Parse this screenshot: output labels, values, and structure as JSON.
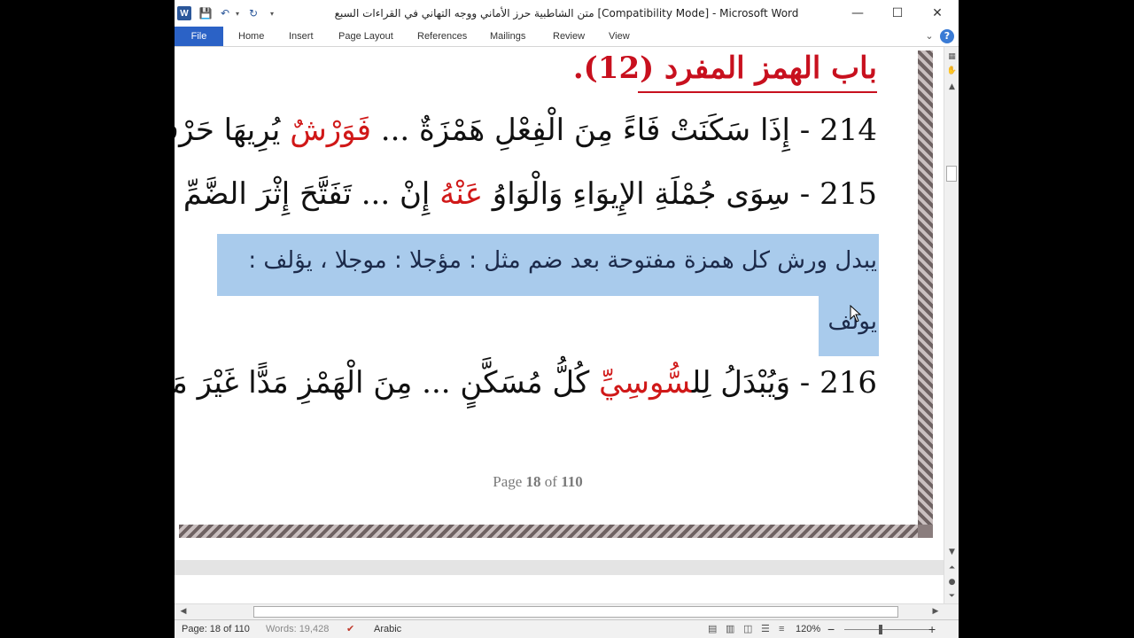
{
  "window": {
    "title": "متن الشاطبية حرز الأماني ووجه التهاني في القراءات السبع [Compatibility Mode]  -  Microsoft Word",
    "app_icon": "W",
    "minimize": "—",
    "maximize": "☐",
    "close": "✕"
  },
  "quick_access": {
    "save_icon": "💾",
    "undo_icon": "↶",
    "redo_icon": "↻",
    "dropdown_icon": "▾"
  },
  "ribbon": {
    "file": "File",
    "tabs": [
      "Home",
      "Insert",
      "Page Layout",
      "References",
      "Mailings",
      "Review",
      "View"
    ],
    "minimize_icon": "⌄",
    "help_icon": "?"
  },
  "document": {
    "heading": "باب الهمز المفرد (12).",
    "verse_214": {
      "num": "214",
      "part1": " - إِذَا سَكَنَتْ فَاءً مِنَ الْفِعْلِ هَمْزَةٌ ... ",
      "red": "فَوَرْشٌ",
      "part2": " يُرِيهَا حَرْفَ مَدٍّ مُبَدِّلَا"
    },
    "verse_215": {
      "num": "215",
      "part1": " - سِوَى جُمْلَةِ الإِيوَاءِ وَالْوَاوُ ",
      "red": "عَنْهُ",
      "part2": " إِنْ ... تَفَتَّحَ إِثْرَ الضَّمِّ نَحْوُ مُؤَجَّلَا"
    },
    "explanation_line1": "يبدل ورش كل همزة مفتوحة بعد ضم مثل : مؤجلا : موجلا ، يؤلف :",
    "explanation_line2": "يولف",
    "verse_216": {
      "num": "216",
      "part1": " - وَيُبْدَلُ لِل",
      "red": "سُّوسِيِّ",
      "part2": " كُلُّ مُسَكَّنٍ ... مِنَ الْهَمْزِ مَدًّا غَيْرَ مَجْزُومٍ اُهْمِلَا"
    },
    "page_label": "Page",
    "page_current": "18",
    "page_of": "of",
    "page_total": "110"
  },
  "status_bar": {
    "page": "Page: 18 of 110",
    "words": "Words: 19,428",
    "language": "Arabic",
    "zoom": "120%",
    "zoom_minus": "−",
    "zoom_plus": "+"
  }
}
